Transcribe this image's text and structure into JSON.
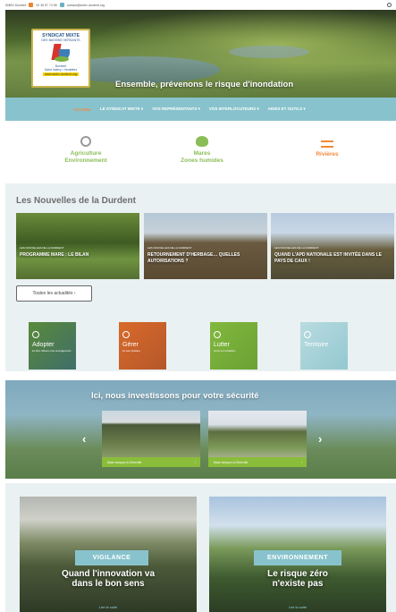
{
  "topbar": {
    "org": "SMBV Durdent",
    "phone": "02 35 57 74 56",
    "email": "contact@smbv-durdent.org"
  },
  "hero": {
    "logo": {
      "line1": "SYNDICAT MIXTE",
      "line2": "DES BASSINS VERSANTS",
      "line3": "Durdent\nSaint Valery • Veulettes",
      "line4": "www.smbv-durdent.org"
    },
    "tagline": "Ensemble, prévenons le risque d'inondation"
  },
  "nav": {
    "items": [
      "ACCUEIL",
      "LE SYNDICAT MIXTE ▾",
      "VOS REPRÉSENTANTS ▾",
      "VOS INTERLOCUTEURS ▾",
      "AIDES ET OUTILS ▾"
    ],
    "colors": {
      "bar": "#88c3cd",
      "active": "#f18a3a"
    }
  },
  "themes": [
    {
      "label": "Agriculture\nEnvironnement",
      "icon": "sun-gear-icon"
    },
    {
      "label": "Mares\nZones humides",
      "icon": "water-drop-icon"
    },
    {
      "label": "Rivières",
      "icon": "waves-icon"
    }
  ],
  "news": {
    "title": "Les Nouvelles de la Durdent",
    "cards": [
      {
        "category": "LES NOUVELLES DE LA DURDENT",
        "title": "PROGRAMME MARE : LE BILAN"
      },
      {
        "category": "LES NOUVELLES DE LA DURDENT",
        "title": "RETOURNEMENT D'HERBAGE… QUELLES AUTORISATIONS ?"
      },
      {
        "category": "LES NOUVELLES DE LA DURDENT",
        "title": "QUAND L'APD NATIONALE EST INVITÉE DANS LE PAYS DE CAUX !"
      }
    ],
    "all_button": "Toutes les actualités ›"
  },
  "tiles": [
    {
      "label": "Adopter",
      "sub": "les bons réflexes et les aménagements"
    },
    {
      "label": "Gérer",
      "sub": "les eaux pluviales"
    },
    {
      "label": "Lutter",
      "sub": "contre les inondations"
    },
    {
      "label": "Territoire",
      "sub": ""
    }
  ],
  "invest": {
    "title": "Ici, nous investissons pour votre sécurité",
    "slides": [
      {
        "caption": "Mare tampon à Oherville"
      },
      {
        "caption": "Mare tampon à Oherville"
      }
    ],
    "prev": "‹",
    "next": "›"
  },
  "features": [
    {
      "badge": "VIGILANCE",
      "headline": "Quand l'innovation va\ndans le bon sens",
      "more": "Lire la suite"
    },
    {
      "badge": "ENVIRONNEMENT",
      "headline": "Le risque zéro\nn'existe pas",
      "more": "Lire la suite"
    }
  ]
}
